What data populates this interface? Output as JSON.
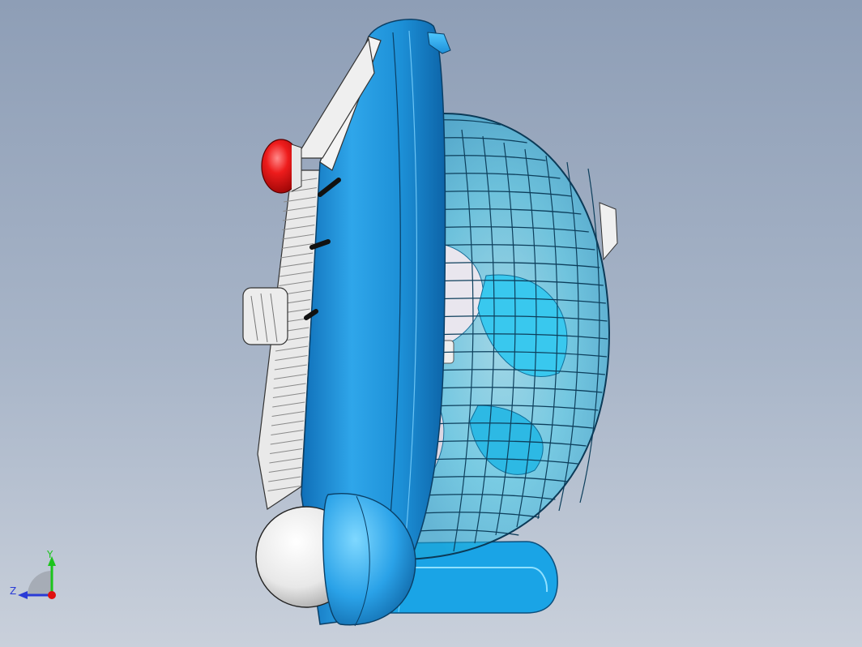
{
  "scene": {
    "model": "desk-fan",
    "view": "side",
    "background_top": "#8e9eb6",
    "background_bottom": "#c9d0db",
    "colors": {
      "body_blue": "#1e90d8",
      "grill_cyan": "#27c3e8",
      "knob_red": "#e81616",
      "white_parts": "#f2f2f2"
    }
  },
  "triad": {
    "y_label": "Y",
    "z_label": "Z",
    "colors": {
      "y": "#1cc41c",
      "z": "#2a3bd6",
      "origin": "#e01010"
    }
  }
}
